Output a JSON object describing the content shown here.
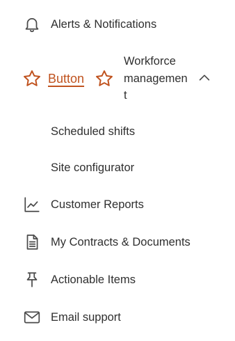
{
  "nav": {
    "alerts": {
      "label": "Alerts & Notifications",
      "icon": "bell-icon"
    },
    "workforce": {
      "button_label": "Button",
      "label": "Workforce management",
      "expanded": true,
      "accent_color": "#c0531f",
      "icons": [
        "star-icon",
        "star-icon",
        "chevron-up-icon"
      ]
    },
    "scheduled_shifts": {
      "label": "Scheduled shifts"
    },
    "site_configurator": {
      "label": "Site configurator"
    },
    "customer_reports": {
      "label": "Customer Reports",
      "icon": "line-chart-icon"
    },
    "contracts": {
      "label": "My Contracts & Documents",
      "icon": "document-icon"
    },
    "actionable": {
      "label": "Actionable Items",
      "icon": "pin-icon"
    },
    "email": {
      "label": "Email support",
      "icon": "mail-icon"
    }
  }
}
